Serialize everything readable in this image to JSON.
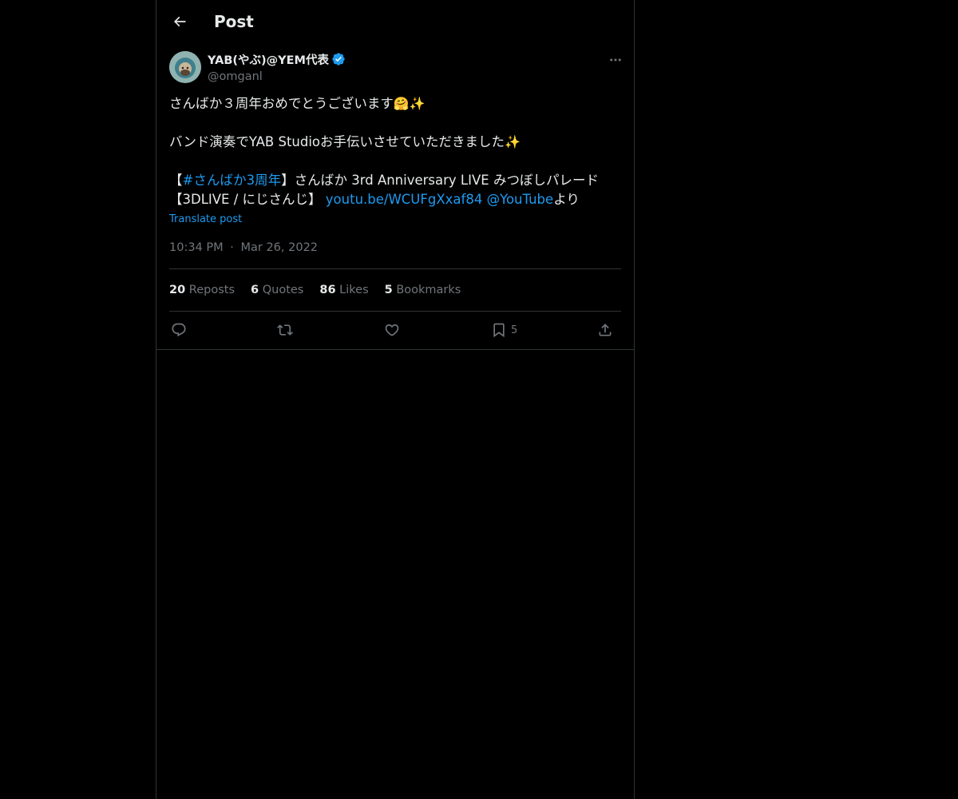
{
  "header": {
    "title": "Post"
  },
  "author": {
    "display_name": "YAB(やぶ)@YEM代表",
    "handle": "@omganl",
    "verified": true
  },
  "tweet": {
    "line1": "さんばか３周年おめでとうございます",
    "line1_emoji": "🤗✨",
    "line2": "バンド演奏でYAB Studioお手伝いさせていただきました",
    "line2_emoji": "✨",
    "line3_prefix": "【",
    "line3_hashtag": "#さんばか3周年",
    "line3_suffix": "】さんばか 3rd Anniversary LIVE みつぼしパレード",
    "line4_prefix": "【3DLIVE / にじさんじ】 ",
    "line4_link": "youtu.be/WCUFgXxaf84",
    "line4_mention": "@YouTube",
    "line4_suffix": "より",
    "translate_label": "Translate post"
  },
  "meta": {
    "time": "10:34 PM",
    "separator": "·",
    "date": "Mar 26, 2022"
  },
  "stats": {
    "reposts_count": "20",
    "reposts_label": "Reposts",
    "quotes_count": "6",
    "quotes_label": "Quotes",
    "likes_count": "86",
    "likes_label": "Likes",
    "bookmarks_count": "5",
    "bookmarks_label": "Bookmarks"
  },
  "actions": {
    "reply_icon": "reply-icon",
    "repost_icon": "repost-icon",
    "like_icon": "heart-icon",
    "bookmark_icon": "bookmark-icon",
    "bookmark_count": "5",
    "share_icon": "share-icon"
  },
  "colors": {
    "background": "#000000",
    "text": "#e7e9ea",
    "secondary": "#71767b",
    "accent": "#1d9bf0",
    "border": "#2f3336"
  }
}
